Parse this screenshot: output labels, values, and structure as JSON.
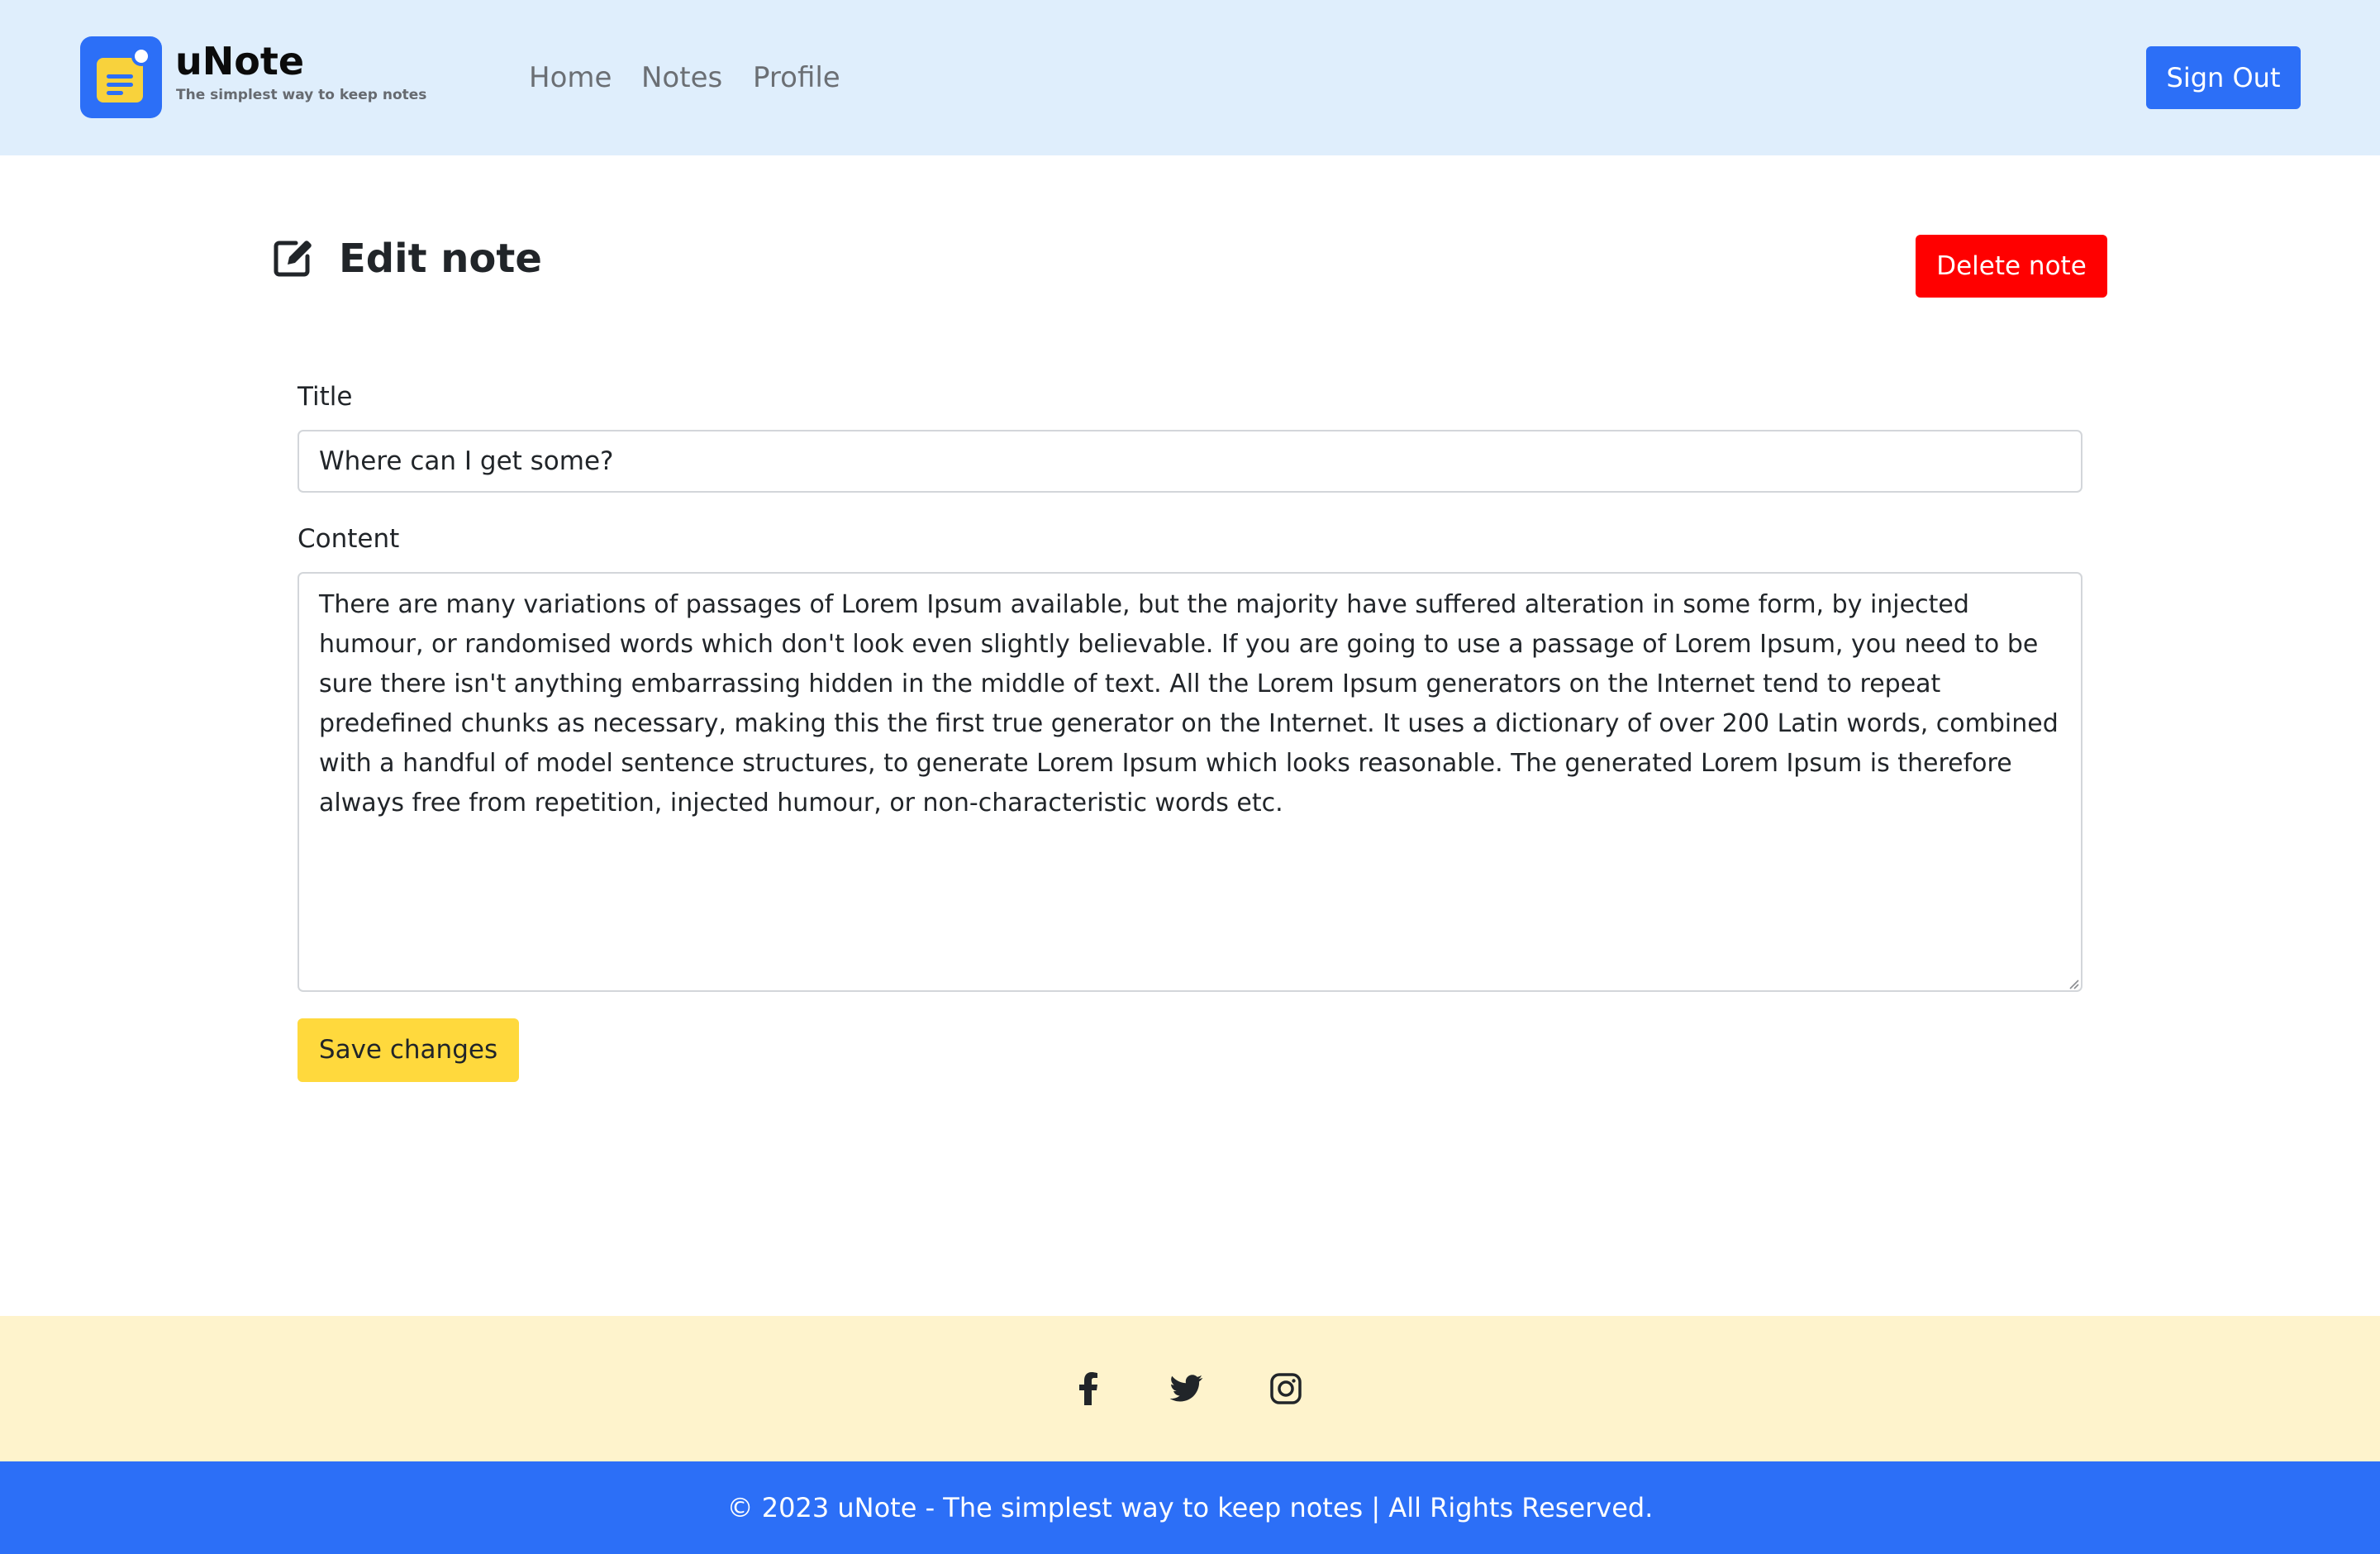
{
  "header": {
    "brand_name": "uNote",
    "brand_tagline": "The simplest way to keep notes",
    "nav": [
      {
        "label": "Home"
      },
      {
        "label": "Notes"
      },
      {
        "label": "Profile"
      }
    ],
    "sign_out_label": "Sign Out"
  },
  "page": {
    "title": "Edit note",
    "delete_label": "Delete note"
  },
  "form": {
    "title_label": "Title",
    "title_value": "Where can I get some?",
    "content_label": "Content",
    "content_value": "There are many variations of passages of Lorem Ipsum available, but the majority have suffered alteration in some form, by injected humour, or randomised words which don't look even slightly believable. If you are going to use a passage of Lorem Ipsum, you need to be sure there isn't anything embarrassing hidden in the middle of text. All the Lorem Ipsum generators on the Internet tend to repeat predefined chunks as necessary, making this the first true generator on the Internet. It uses a dictionary of over 200 Latin words, combined with a handful of model sentence structures, to generate Lorem Ipsum which looks reasonable. The generated Lorem Ipsum is therefore always free from repetition, injected humour, or non-characteristic words etc.",
    "save_label": "Save changes"
  },
  "footer": {
    "social_icons": [
      "facebook-icon",
      "twitter-icon",
      "instagram-icon"
    ],
    "copyright": "© 2023 uNote - The simplest way to keep notes | All Rights Reserved."
  },
  "colors": {
    "header_bg": "#dfeefc",
    "primary": "#2c6ff7",
    "danger": "#ff0000",
    "warning": "#ffd93d",
    "social_bar_bg": "#fef3cc"
  }
}
